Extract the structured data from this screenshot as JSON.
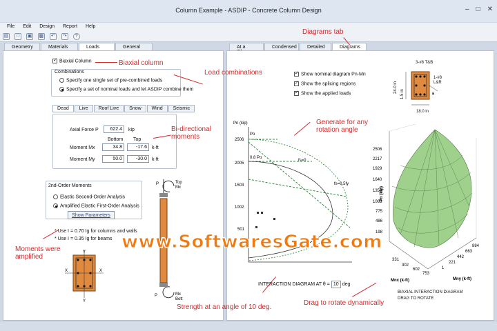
{
  "window": {
    "title": "Column Example - ASDIP - Concrete Column Design"
  },
  "menu": [
    "File",
    "Edit",
    "Design",
    "Report",
    "Help"
  ],
  "left_tabs": [
    "Geometry",
    "Materials",
    "Loads",
    "General"
  ],
  "right_tabs": [
    "At a Glance",
    "Condensed",
    "Detailed",
    "Diagrams"
  ],
  "loads": {
    "biaxial_label": "Biaxial Column",
    "combinations_title": "Combinations",
    "combo_option_1": "Specify one single set of pre-combined loads",
    "combo_option_2": "Specify a set of nominal loads and let ASDIP combine them",
    "load_tabs": [
      "Dead",
      "Live",
      "Roof Live",
      "Snow",
      "Wind",
      "Seismic"
    ],
    "axial_label": "Axial Force  P",
    "axial_value": "622.4",
    "axial_unit": "kip",
    "bottom_header": "Bottom",
    "top_header": "Top",
    "mx_label": "Moment Mx",
    "mx_bottom": "34.8",
    "mx_top": "-17.6",
    "mx_unit": "k-ft",
    "my_label": "Moment My",
    "my_bottom": "50.0",
    "my_top": "-30.0",
    "my_unit": "k-ft"
  },
  "second_order": {
    "title": "2nd-Order Moments",
    "option_1": "Elastic Second-Order Analysis",
    "option_2": "Amplified Elastic First-Order Analysis",
    "params_button": "Show Parameters",
    "note_1": "* Use I = 0.70 Ig for columns and walls",
    "note_2": "* Use I = 0.35 Ig for beams"
  },
  "callouts": {
    "biaxial": "Biaxial column",
    "load_combinations": "Load combinations",
    "diagrams_tab": "Diagrams tab",
    "bi_directional": "Bi-directional\nmoments",
    "generate": "Generate for any\nrotation angle",
    "moments_amplified": "Moments were\namplified",
    "strength_angle": "Strength at an angle of 10 deg.",
    "drag_rotate": "Drag to rotate dynamically"
  },
  "diagrams": {
    "show_nominal": "Show nominal diagram Pn-Mn",
    "show_splicing": "Show the splicing regions",
    "show_loads": "Show the applied loads",
    "interaction_label": "INTERACTION DIAGRAM AT θ =",
    "theta_value": "10",
    "theta_unit": "deg",
    "pn_axis": "Pn (kip)",
    "po_label": "Po",
    "po08_label": "0.8 Po",
    "fs0": "fs=0",
    "fs05": "fs=0.5fy",
    "mn_axis": "Mn (k-ft)",
    "biaxial_title": "BIAXIAL INTERACTION DIAGRAM",
    "drag_caption": "DRAG TO ROTATE",
    "section_top_label": "3-#8 T&B",
    "section_side_label": "1-#8\nL&R",
    "section_width": "18.0 in",
    "section_height": "24.0 in",
    "section_cover": "1.5 in"
  },
  "chart_data": [
    {
      "type": "line",
      "title": "INTERACTION DIAGRAM AT θ = 10 deg",
      "ylabel": "Pn (kip)",
      "xlabel": "Mn (k-ft)",
      "y_ticks": [
        "2506",
        "2005",
        "1503",
        "1002",
        "501"
      ]
    },
    {
      "type": "surface",
      "title": "BIAXIAL INTERACTION DIAGRAM",
      "zlabel": "Pn (kip)",
      "xlabel": "Mnx (k-ft)",
      "ylabel": "Mny (k-ft)",
      "z_ticks": [
        "2506",
        "2217",
        "1929",
        "1640",
        "1352",
        "1063",
        "775",
        "486",
        "198"
      ],
      "x_ticks": [
        "331",
        "331",
        "302",
        "602",
        "753"
      ],
      "y_ticks": [
        "1",
        "221",
        "442",
        "663",
        "884"
      ]
    }
  ],
  "watermark": "www.SoftwaresGate.com",
  "colors": {
    "callout": "#d42a2a",
    "surface": "#9fd08c",
    "watermark": "#f07a10"
  }
}
